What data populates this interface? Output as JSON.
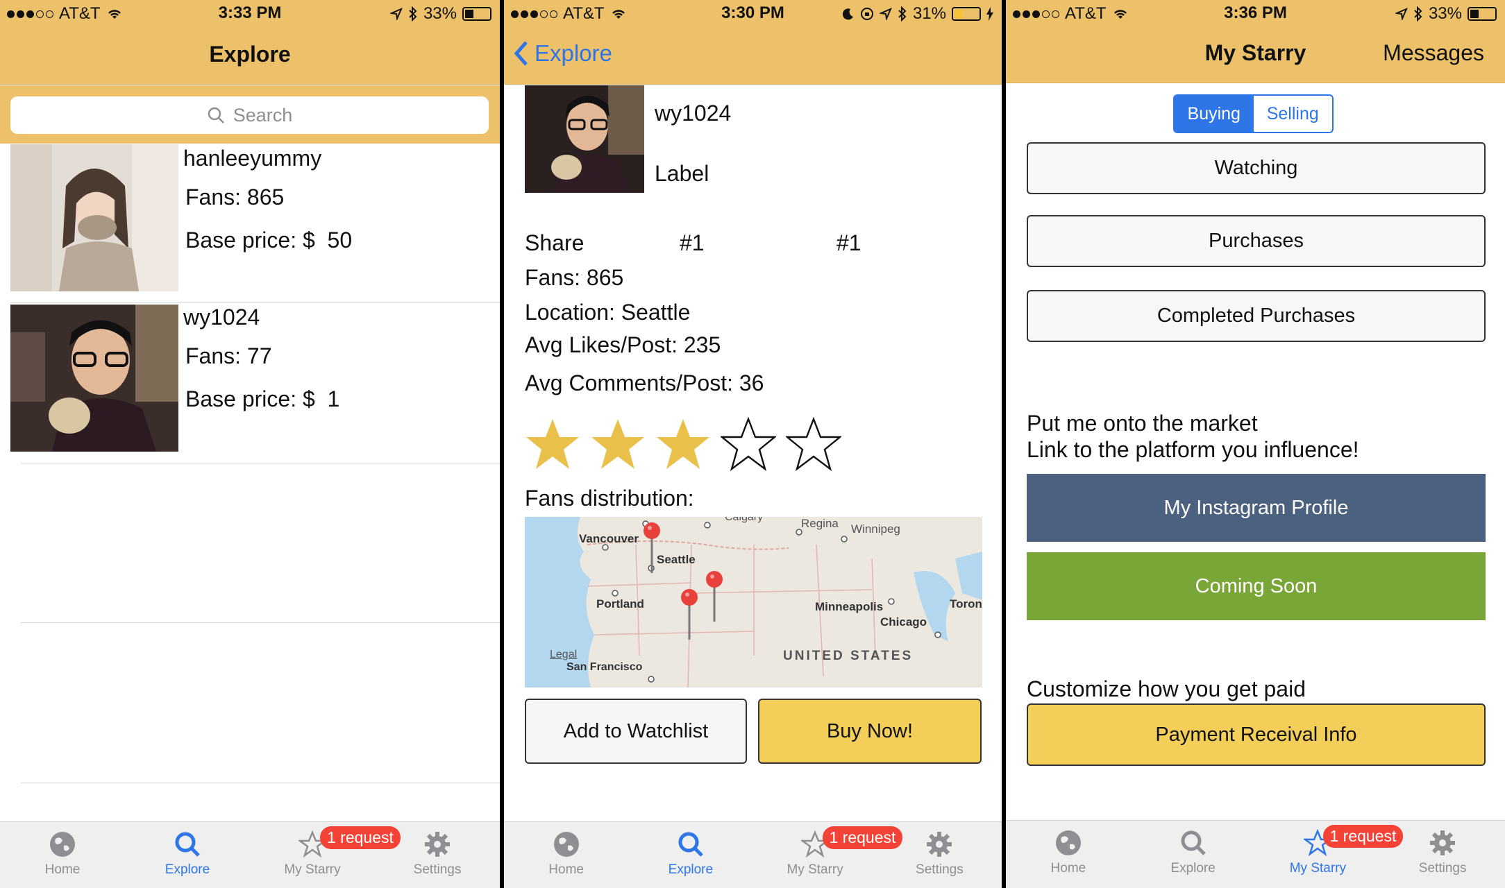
{
  "colors": {
    "nav_bg": "#edc16a",
    "accent_blue": "#2e76e8",
    "star_gold": "#e8c04a",
    "badge_red": "#f44336",
    "instagram_blue": "#4c6180",
    "coming_soon_green": "#79a637",
    "buy_yellow": "#f3cf5a"
  },
  "tabs": [
    {
      "label": "Home",
      "icon": "globe-icon"
    },
    {
      "label": "Explore",
      "icon": "search-icon"
    },
    {
      "label": "My Starry",
      "icon": "star-icon"
    },
    {
      "label": "Settings",
      "icon": "gear-icon"
    }
  ],
  "badge": "1 request",
  "screens": {
    "explore": {
      "status": {
        "carrier": "AT&T",
        "time": "3:33 PM",
        "battery": "33%"
      },
      "title": "Explore",
      "search_placeholder": "Search",
      "items": [
        {
          "name": "hanleeyummy",
          "fans": "Fans: 865",
          "price": "Base price: $  50"
        },
        {
          "name": "wy1024",
          "fans": "Fans: 77",
          "price": "Base price: $  1"
        }
      ]
    },
    "detail": {
      "status": {
        "carrier": "AT&T",
        "time": "3:30 PM",
        "battery": "31%"
      },
      "back_label": "Explore",
      "username": "wy1024",
      "label": "Label",
      "share_label": "Share",
      "rank1": "#1",
      "rank2": "#1",
      "fans": "Fans: 865",
      "location": "Location: Seattle",
      "avg_likes": "Avg Likes/Post: 235",
      "avg_comments": "Avg Comments/Post: 36",
      "rating": 3,
      "rating_max": 5,
      "fans_distribution_label": "Fans distribution:",
      "map": {
        "labels": [
          "Vancouver",
          "Seattle",
          "Portland",
          "San Francisco",
          "Calgary",
          "Regina",
          "Winnipeg",
          "Minneapolis",
          "Chicago",
          "Toron",
          "UNITED STATES",
          "Legal"
        ]
      },
      "watchlist_button": "Add to Watchlist",
      "buy_button": "Buy Now!"
    },
    "mystarry": {
      "status": {
        "carrier": "AT&T",
        "time": "3:36 PM",
        "battery": "33%"
      },
      "title": "My Starry",
      "messages_button": "Messages",
      "segment": [
        "Buying",
        "Selling"
      ],
      "watching": "Watching",
      "purchases": "Purchases",
      "completed_purchases": "Completed Purchases",
      "market_line1": "Put me onto the market",
      "market_line2": "Link to the platform you influence!",
      "instagram_button": "My Instagram Profile",
      "coming_soon_button": "Coming Soon",
      "customize_label": "Customize how you get paid",
      "payment_button": "Payment Receival Info"
    }
  }
}
